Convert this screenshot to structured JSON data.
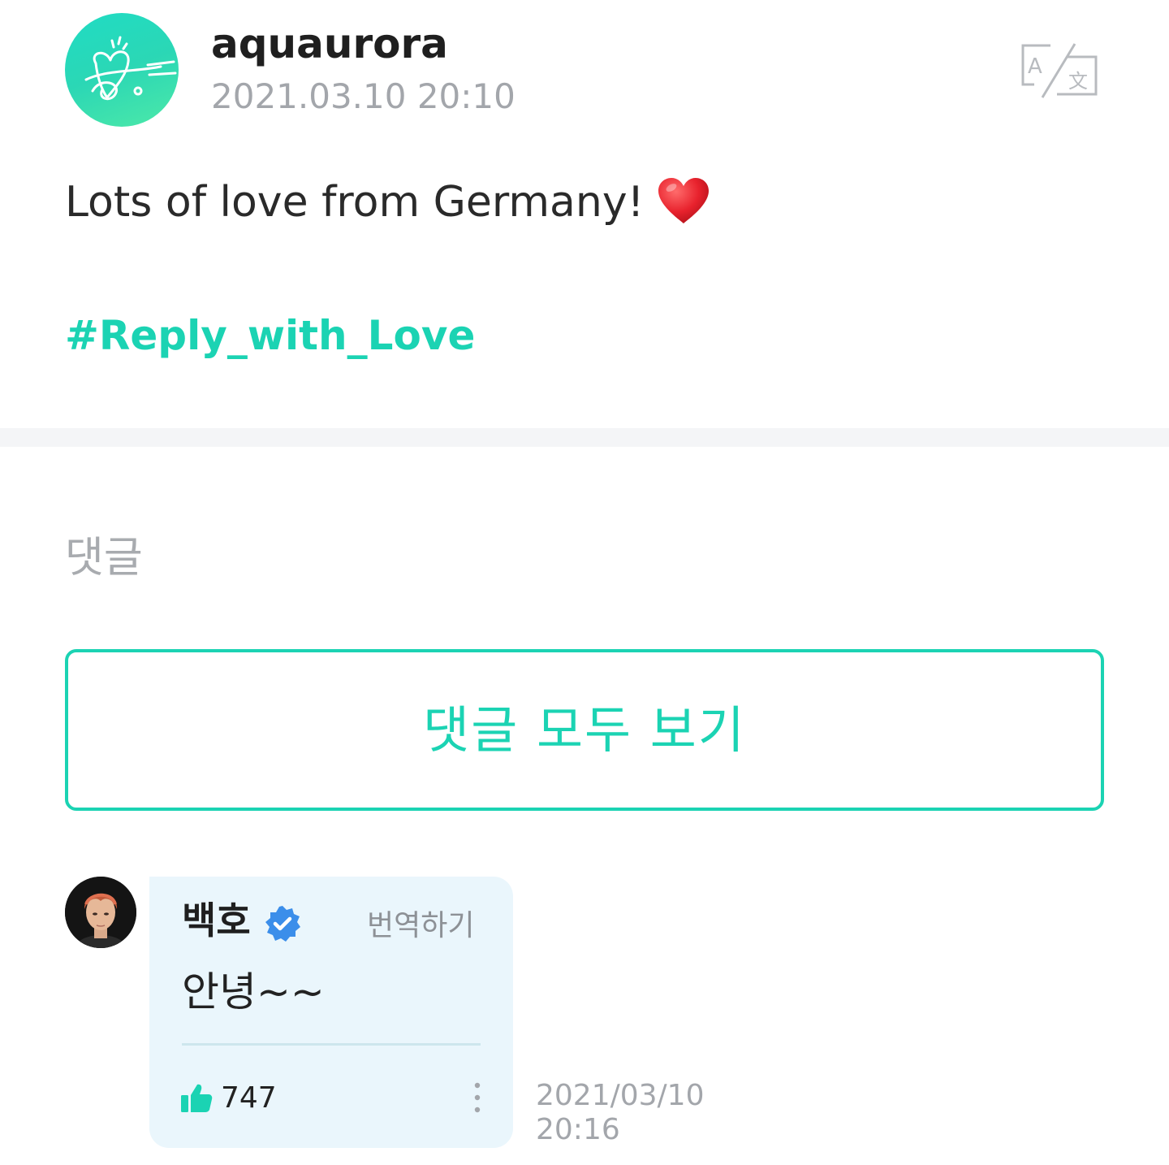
{
  "post": {
    "author": "aquaurora",
    "date": "2021.03.10 20:10",
    "text": "Lots of love from Germany!",
    "emoji": "red-heart",
    "hashtag": "#Reply_with_Love",
    "translate_icon": "translate-icon"
  },
  "comments": {
    "heading": "댓글",
    "view_all_label": "댓글 모두 보기"
  },
  "artist_reply": {
    "author": "백호",
    "verified": true,
    "translate_label": "번역하기",
    "text": "안녕~~",
    "like_count": "747",
    "date_line1": "2021/03/10",
    "date_line2": "20:16"
  },
  "colors": {
    "accent": "#1bd3b3",
    "muted_text": "#a3a6ab",
    "reply_bubble": "#eaf6fc",
    "verified_blue": "#3b8eea"
  }
}
